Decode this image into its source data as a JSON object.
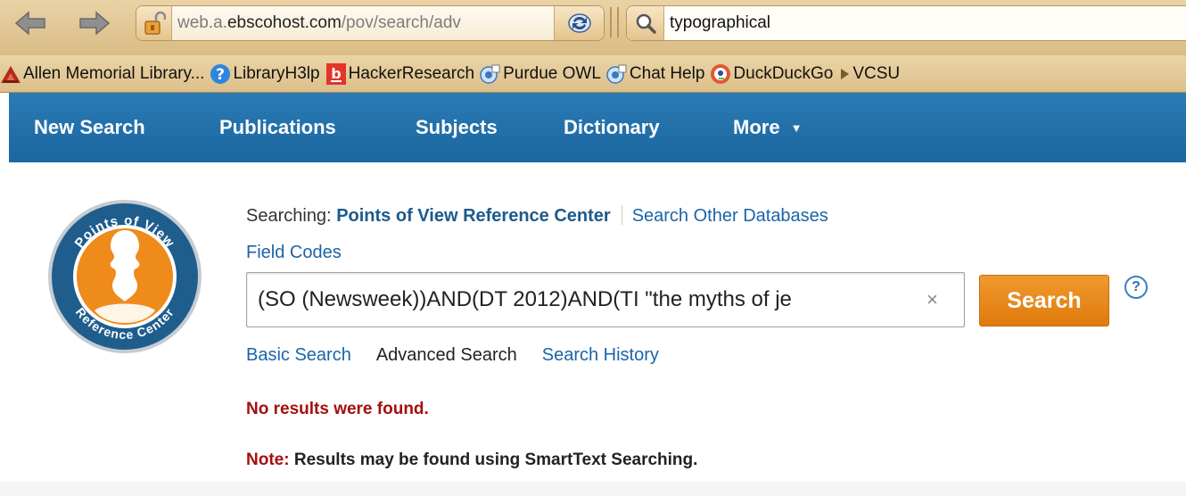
{
  "browser": {
    "url": {
      "faded": "web.a.",
      "host": "ebscohost.com",
      "path": "/pov/search/adv"
    },
    "search_query": "typographical"
  },
  "bookmarks": [
    {
      "label": "Allen Memorial Library...",
      "icon": "library-icon"
    },
    {
      "label": "LibraryH3lp",
      "icon": "question-icon"
    },
    {
      "label": "HackerResearch",
      "icon": "b-icon"
    },
    {
      "label": "Purdue OWL",
      "icon": "bookmark-page-icon"
    },
    {
      "label": "Chat Help",
      "icon": "bookmark-page-icon"
    },
    {
      "label": "DuckDuckGo",
      "icon": "duck-icon"
    },
    {
      "label": "VCSU",
      "icon": "folder-arrow-icon"
    }
  ],
  "nav": {
    "new_search": "New Search",
    "publications": "Publications",
    "subjects": "Subjects",
    "dictionary": "Dictionary",
    "more": "More",
    "more_caret": "▼"
  },
  "logo": {
    "top_text": "Points of View",
    "bottom_text": "Reference Center"
  },
  "search": {
    "searching_label": "Searching:",
    "database": "Points of View Reference Center",
    "other_db_link": "Search Other Databases",
    "field_codes": "Field Codes",
    "query": "(SO (Newsweek))AND(DT 2012)AND(TI \"the myths of je",
    "clear": "×",
    "button": "Search",
    "help": "?",
    "modes": {
      "basic": "Basic Search",
      "advanced": "Advanced Search",
      "history": "Search History"
    }
  },
  "results": {
    "no_results": "No results were found.",
    "note_label": "Note:",
    "note_text": " Results may be found using SmartText Searching."
  },
  "colors": {
    "nav_blue": "#1b669f",
    "search_orange": "#e88414",
    "error_red": "#a50e0e",
    "link_blue": "#1b64a8"
  }
}
